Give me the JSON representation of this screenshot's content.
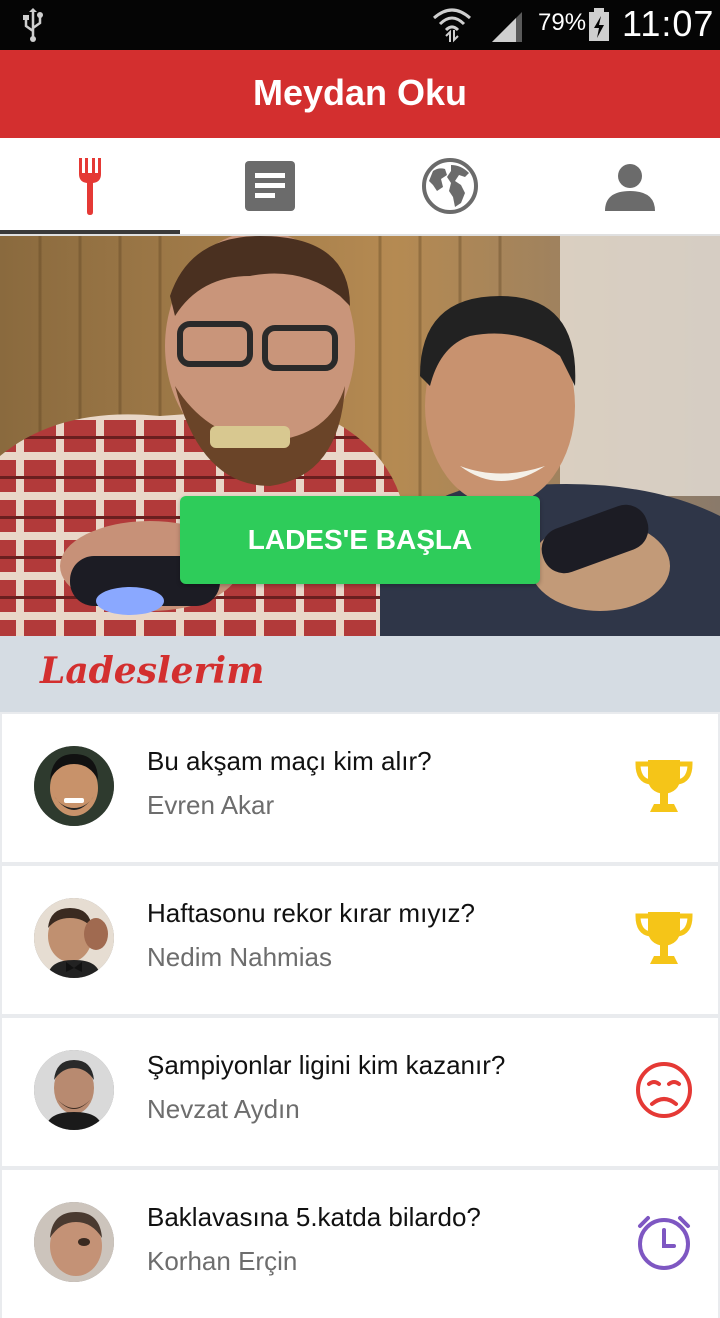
{
  "status_bar": {
    "battery_percent": "79%",
    "time": "11:07",
    "icons": [
      "usb-icon",
      "wifi-icon",
      "signal-icon",
      "battery-charging-icon"
    ]
  },
  "app_bar": {
    "title": "Meydan Oku"
  },
  "tabs": [
    {
      "icon": "fork-icon",
      "active": true
    },
    {
      "icon": "document-icon",
      "active": false
    },
    {
      "icon": "globe-icon",
      "active": false
    },
    {
      "icon": "profile-icon",
      "active": false
    }
  ],
  "hero": {
    "cta_label": "LADES'E BAŞLA"
  },
  "section": {
    "title": "Ladeslerim"
  },
  "items": [
    {
      "question": "Bu akşam maçı kim alır?",
      "name": "Evren Akar",
      "status": "trophy-icon"
    },
    {
      "question": "Haftasonu rekor kırar mıyız?",
      "name": "Nedim Nahmias",
      "status": "trophy-icon"
    },
    {
      "question": "Şampiyonlar ligini kim kazanır?",
      "name": "Nevzat Aydın",
      "status": "sad-face-icon"
    },
    {
      "question": "Baklavasına 5.katda bilardo?",
      "name": "Korhan Erçin",
      "status": "clock-icon"
    }
  ],
  "colors": {
    "primary": "#d32f2f",
    "cta_green": "#2ecc5a",
    "trophy": "#f5c518",
    "lost": "#e53935",
    "pending": "#7e57c2",
    "section_bg": "#d5dce3"
  }
}
